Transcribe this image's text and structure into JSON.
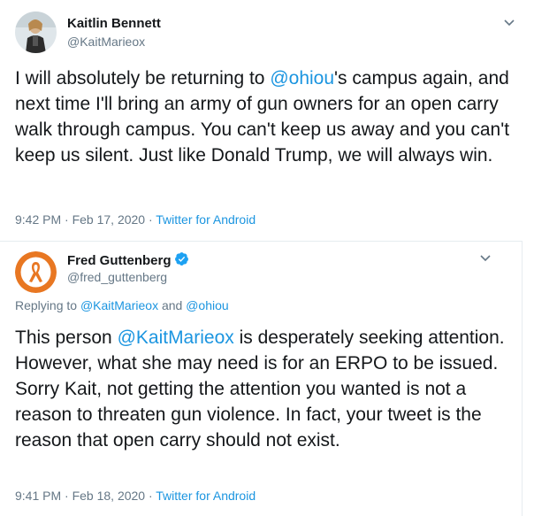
{
  "tweet1": {
    "author_name": "Kaitlin Bennett",
    "author_handle": "@KaitMarieox",
    "text_part1": "I will absolutely be returning to ",
    "mention": "@ohiou",
    "text_part2": "'s campus again, and next time I'll bring an army of gun owners for an open carry walk through campus. You can't keep us away and you can't keep us silent. Just like Donald Trump, we will always win.",
    "timestamp": "9:42 PM · Feb 17, 2020 · ",
    "source": "Twitter for Android"
  },
  "tweet2": {
    "author_name": "Fred Guttenberg",
    "author_handle": "@fred_guttenberg",
    "replying_prefix": "Replying to ",
    "reply_user1": "@KaitMarieox",
    "reply_and": " and ",
    "reply_user2": "@ohiou",
    "text_part1": "This person ",
    "mention": "@KaitMarieox",
    "text_part2": " is desperately seeking attention.  However, what she may need is for an ERPO to be issued.  Sorry Kait, not getting the attention you wanted is not a reason to threaten gun violence.  In fact, your tweet is the reason that open carry should not exist.",
    "timestamp": "9:41 PM · Feb 18, 2020 · ",
    "source": "Twitter for Android"
  },
  "icons": {
    "caret": "chevron-down-icon",
    "verified": "verified-badge-icon"
  },
  "colors": {
    "link": "#1b95e0",
    "text": "#14171a",
    "secondary": "#657786",
    "ribbon": "#e87722"
  }
}
